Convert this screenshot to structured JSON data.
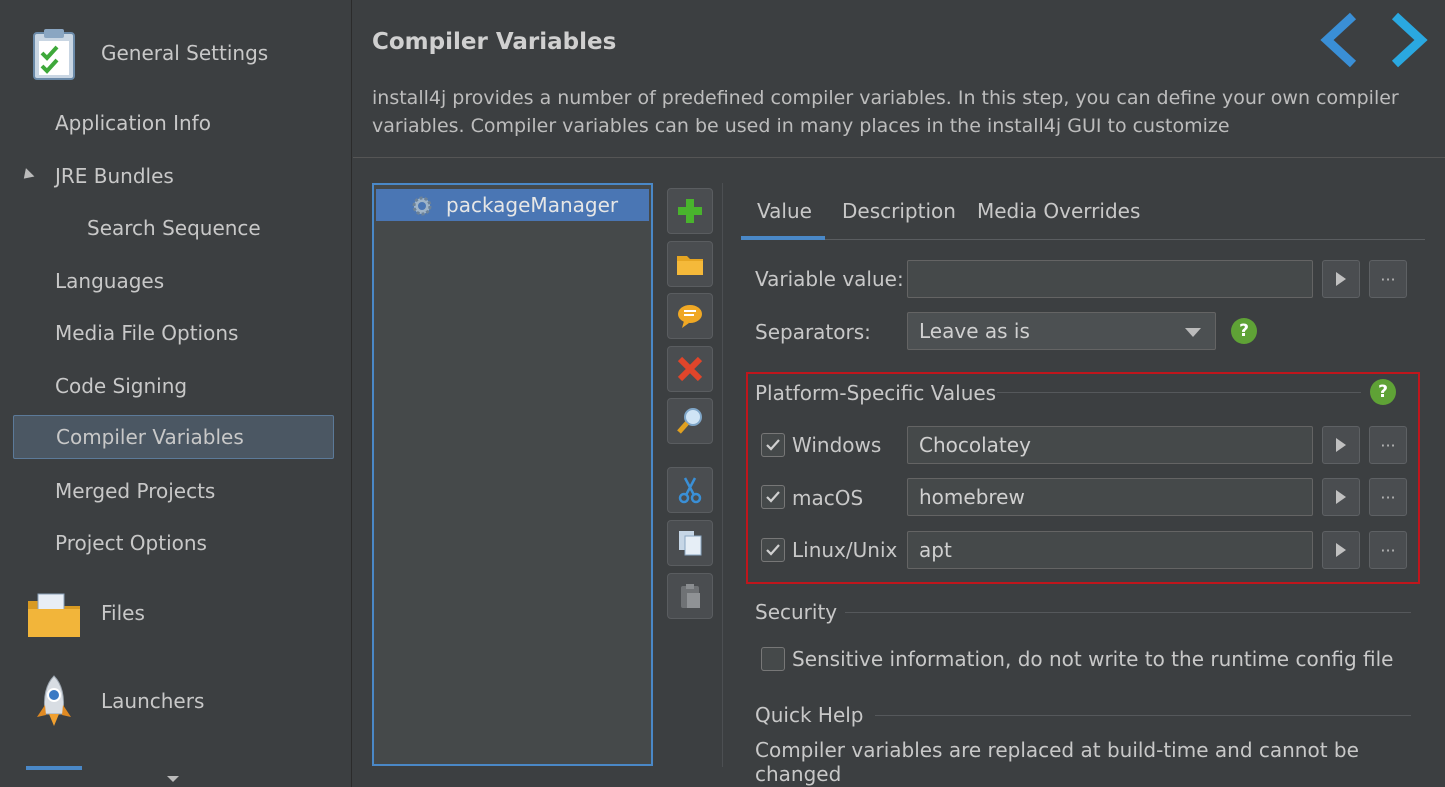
{
  "sidebar": {
    "categories": [
      {
        "label": "General Settings",
        "icon": "clipboard-check-icon"
      },
      {
        "label": "Files",
        "icon": "folder-icon"
      },
      {
        "label": "Launchers",
        "icon": "rocket-icon"
      }
    ],
    "items": [
      {
        "label": "Application Info"
      },
      {
        "label": "JRE Bundles"
      },
      {
        "label": "Search Sequence"
      },
      {
        "label": "Languages"
      },
      {
        "label": "Media File Options"
      },
      {
        "label": "Code Signing"
      },
      {
        "label": "Compiler Variables"
      },
      {
        "label": "Merged Projects"
      },
      {
        "label": "Project Options"
      }
    ],
    "selected": "Compiler Variables"
  },
  "main": {
    "title": "Compiler Variables",
    "description": "install4j provides a number of predefined compiler variables. In this step, you can define your own compiler variables. Compiler variables can be used in many places in the install4j GUI to customize"
  },
  "variable_list": {
    "items": [
      {
        "label": "packageManager",
        "selected": true
      }
    ]
  },
  "toolbar": {
    "buttons": [
      "add-icon",
      "folder-icon",
      "comment-icon",
      "delete-icon",
      "search-icon",
      "cut-icon",
      "copy-icon",
      "paste-icon"
    ]
  },
  "tabs": [
    {
      "label": "Value",
      "active": true
    },
    {
      "label": "Description",
      "active": false
    },
    {
      "label": "Media Overrides",
      "active": false
    }
  ],
  "form": {
    "variable_value_label": "Variable value:",
    "variable_value": "",
    "separators_label": "Separators:",
    "separators_value": "Leave as is",
    "more_label": "···",
    "help_label": "?"
  },
  "platform": {
    "title": "Platform-Specific Values",
    "rows": [
      {
        "label": "Windows",
        "checked": true,
        "value": "Chocolatey"
      },
      {
        "label": "macOS",
        "checked": true,
        "value": "homebrew"
      },
      {
        "label": "Linux/Unix",
        "checked": true,
        "value": "apt"
      }
    ]
  },
  "security": {
    "title": "Security",
    "sensitive_label": "Sensitive information, do not write to the runtime config file",
    "sensitive_checked": false
  },
  "quick_help": {
    "title": "Quick Help",
    "text": "Compiler variables are replaced at build-time and cannot be changed"
  },
  "colors": {
    "accent": "#4a88c7",
    "selection": "#4a76b4",
    "highlight_box": "#c0161c",
    "help_green": "#5fa236"
  }
}
